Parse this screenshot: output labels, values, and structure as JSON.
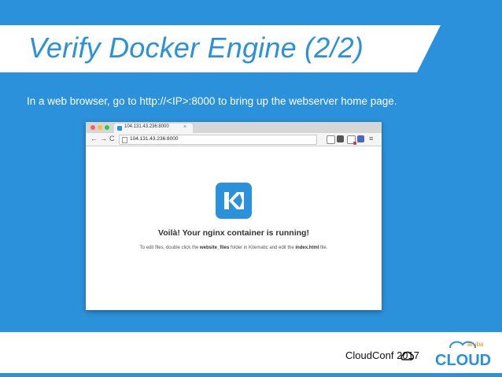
{
  "slide": {
    "title": "Verify Docker Engine (2/2)",
    "subtitle": "In a web browser, go to http://<IP>:8000 to bring up the webserver home page."
  },
  "browser": {
    "tab_title": "104.131.43.236:8000",
    "tab_close": "×",
    "nav_back": "←",
    "nav_forward": "→",
    "nav_reload": "C",
    "url": "104.131.43.236:8000",
    "star": "☆",
    "menu": "≡",
    "page": {
      "headline": "Voilà! Your nginx container is running!",
      "line_pre": "To edit files, double click the ",
      "line_folder": "website_files",
      "line_mid": " folder in Kitematic and edit the ",
      "line_file": "index.html",
      "line_post": " file."
    }
  },
  "footer": {
    "cloudconf_label": "CloudConf",
    "cloudconf_year": "2017",
    "aruba_label": "aruba",
    "cloud_label": "CLOUD"
  },
  "colors": {
    "background": "#2b91da",
    "title": "#2b91da",
    "kitematic": "#2b91da",
    "aruba_orange": "#f28c1e"
  }
}
